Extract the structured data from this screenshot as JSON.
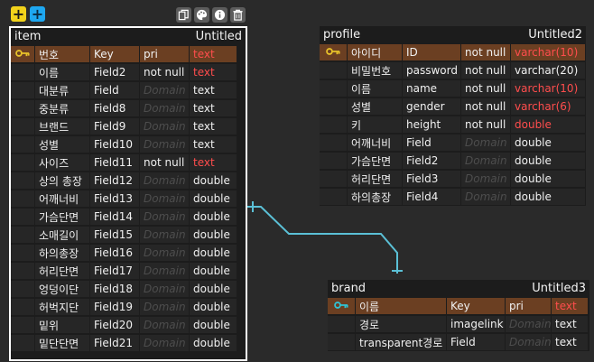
{
  "toolbar": {
    "add_table": "+",
    "add_relation": "+",
    "icons": [
      "copy-icon",
      "palette-icon",
      "info-icon",
      "trash-icon"
    ]
  },
  "tables": [
    {
      "id": "item",
      "name": "item",
      "title": "Untitled",
      "selected": true,
      "rows": [
        {
          "pk": true,
          "name": "번호",
          "field": "Key",
          "type": "pri",
          "domain": "",
          "datatype": "text",
          "red": true
        },
        {
          "pk": false,
          "name": "이름",
          "field": "Field2",
          "type": "not null",
          "domain": "",
          "datatype": "text",
          "red": true
        },
        {
          "pk": false,
          "name": "대분류",
          "field": "Field",
          "type": "",
          "domain": "Domain",
          "datatype": "text",
          "red": false
        },
        {
          "pk": false,
          "name": "중분류",
          "field": "Field8",
          "type": "",
          "domain": "Domain",
          "datatype": "text",
          "red": false
        },
        {
          "pk": false,
          "name": "브랜드",
          "field": "Field9",
          "type": "",
          "domain": "Domain",
          "datatype": "text",
          "red": false
        },
        {
          "pk": false,
          "name": "성별",
          "field": "Field10",
          "type": "",
          "domain": "Domain",
          "datatype": "text",
          "red": false
        },
        {
          "pk": false,
          "name": "사이즈",
          "field": "Field11",
          "type": "not null",
          "domain": "",
          "datatype": "text",
          "red": true
        },
        {
          "pk": false,
          "name": "상의 총장",
          "field": "Field12",
          "type": "",
          "domain": "Domain",
          "datatype": "double",
          "red": false
        },
        {
          "pk": false,
          "name": "어깨너비",
          "field": "Field13",
          "type": "",
          "domain": "Domain",
          "datatype": "double",
          "red": false
        },
        {
          "pk": false,
          "name": "가슴단면",
          "field": "Field14",
          "type": "",
          "domain": "Domain",
          "datatype": "double",
          "red": false
        },
        {
          "pk": false,
          "name": "소매길이",
          "field": "Field15",
          "type": "",
          "domain": "Domain",
          "datatype": "double",
          "red": false
        },
        {
          "pk": false,
          "name": "하의총장",
          "field": "Field16",
          "type": "",
          "domain": "Domain",
          "datatype": "double",
          "red": false
        },
        {
          "pk": false,
          "name": "허리단면",
          "field": "Field17",
          "type": "",
          "domain": "Domain",
          "datatype": "double",
          "red": false
        },
        {
          "pk": false,
          "name": "엉덩이단",
          "field": "Field18",
          "type": "",
          "domain": "Domain",
          "datatype": "double",
          "red": false
        },
        {
          "pk": false,
          "name": "허벅지단",
          "field": "Field19",
          "type": "",
          "domain": "Domain",
          "datatype": "double",
          "red": false
        },
        {
          "pk": false,
          "name": "밑위",
          "field": "Field20",
          "type": "",
          "domain": "Domain",
          "datatype": "double",
          "red": false
        },
        {
          "pk": false,
          "name": "밑단단면",
          "field": "Field21",
          "type": "",
          "domain": "Domain",
          "datatype": "double",
          "red": false
        }
      ]
    },
    {
      "id": "profile",
      "name": "profile",
      "title": "Untitled2",
      "selected": false,
      "rows": [
        {
          "pk": true,
          "name": "아이디",
          "field": "ID",
          "type": "not null",
          "domain": "",
          "datatype": "varchar(10)",
          "red": true
        },
        {
          "pk": false,
          "name": "비밀번호",
          "field": "password",
          "type": "not null",
          "domain": "",
          "datatype": "varchar(20)",
          "red": false
        },
        {
          "pk": false,
          "name": "이름",
          "field": "name",
          "type": "not null",
          "domain": "",
          "datatype": "varchar(10)",
          "red": true
        },
        {
          "pk": false,
          "name": "성별",
          "field": "gender",
          "type": "not null",
          "domain": "",
          "datatype": "varchar(6)",
          "red": true
        },
        {
          "pk": false,
          "name": "키",
          "field": "height",
          "type": "not null",
          "domain": "",
          "datatype": "double",
          "red": true
        },
        {
          "pk": false,
          "name": "어깨너비",
          "field": "Field",
          "type": "",
          "domain": "Domain",
          "datatype": "double",
          "red": false
        },
        {
          "pk": false,
          "name": "가슴단면",
          "field": "Field2",
          "type": "",
          "domain": "Domain",
          "datatype": "double",
          "red": false
        },
        {
          "pk": false,
          "name": "허리단면",
          "field": "Field3",
          "type": "",
          "domain": "Domain",
          "datatype": "double",
          "red": false
        },
        {
          "pk": false,
          "name": "하의총장",
          "field": "Field4",
          "type": "",
          "domain": "Domain",
          "datatype": "double",
          "red": false
        }
      ]
    },
    {
      "id": "brand",
      "name": "brand",
      "title": "Untitled3",
      "selected": false,
      "rows": [
        {
          "pk": true,
          "name": "이름",
          "field": "Key",
          "type": "pri",
          "domain": "",
          "datatype": "text",
          "red": true
        },
        {
          "pk": false,
          "name": "경로",
          "field": "imagelink",
          "type": "",
          "domain": "Domain",
          "datatype": "text",
          "red": false
        },
        {
          "pk": false,
          "name": "transparent경로",
          "field": "Field",
          "type": "",
          "domain": "Domain",
          "datatype": "text",
          "red": false
        }
      ]
    }
  ],
  "colors": {
    "background": "#2a2a2a",
    "table": "#1c1c1c",
    "cell": "#262626",
    "pk_row": "#6b3f22",
    "required": "#ff4d4d",
    "relation": "#5bc0d6",
    "key_icon_primary": "#e8c22a",
    "key_icon_secondary": "#2ec4d6"
  }
}
